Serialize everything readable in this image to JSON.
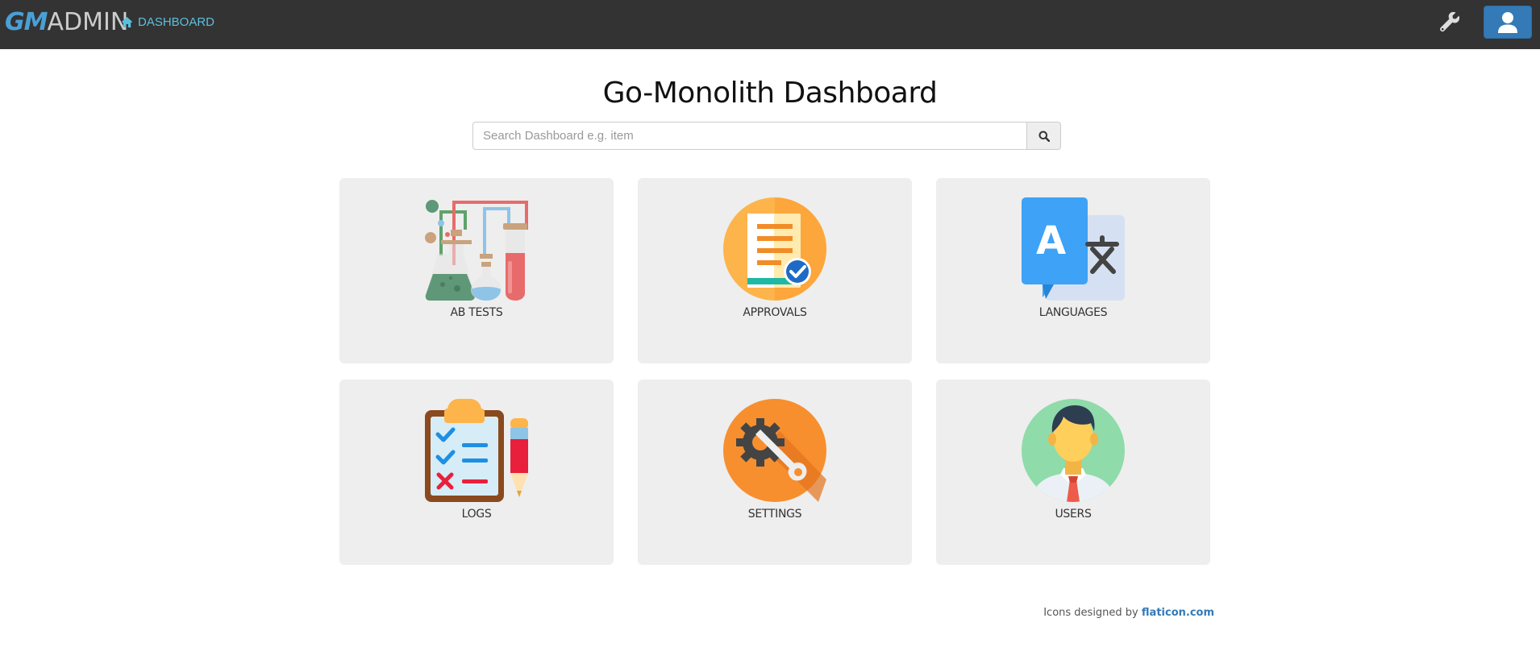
{
  "navbar": {
    "brand_gm": "GM",
    "brand_admin": "ADMIN",
    "home_link": "DASHBOARD"
  },
  "page": {
    "title": "Go-Monolith Dashboard"
  },
  "search": {
    "placeholder": "Search Dashboard e.g. item"
  },
  "tiles": [
    {
      "label": "AB TESTS",
      "icon": "lab-flasks-icon"
    },
    {
      "label": "APPROVALS",
      "icon": "approval-document-icon"
    },
    {
      "label": "LANGUAGES",
      "icon": "translate-icon"
    },
    {
      "label": "LOGS",
      "icon": "checklist-clipboard-icon"
    },
    {
      "label": "SETTINGS",
      "icon": "settings-gear-wrench-icon"
    },
    {
      "label": "USERS",
      "icon": "user-avatar-icon"
    }
  ],
  "footer": {
    "text": "Icons designed by",
    "link": "flaticon.com"
  },
  "colors": {
    "navbar_bg": "#333333",
    "accent_blue": "#337ab7",
    "link_cyan": "#5bc0de",
    "tile_bg": "#eeeeee"
  }
}
